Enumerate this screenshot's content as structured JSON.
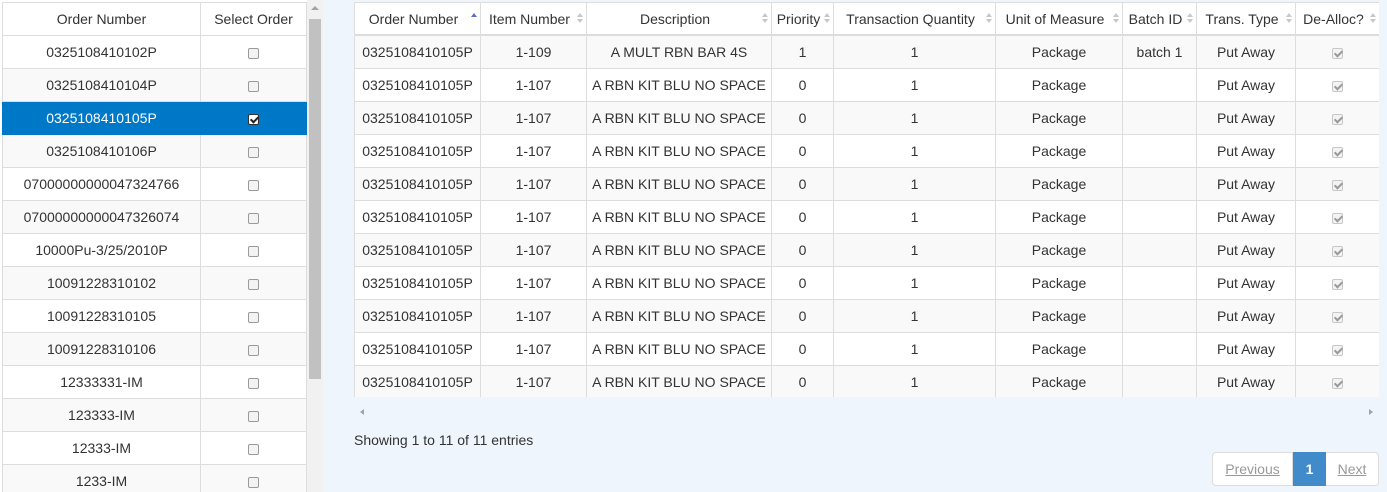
{
  "left": {
    "headers": [
      "Order Number",
      "Select Order"
    ],
    "rows": [
      {
        "order": "0325108410102P",
        "checked": false
      },
      {
        "order": "0325108410104P",
        "checked": false
      },
      {
        "order": "0325108410105P",
        "checked": true,
        "selected": true
      },
      {
        "order": "0325108410106P",
        "checked": false
      },
      {
        "order": "07000000000047324766",
        "checked": false
      },
      {
        "order": "07000000000047326074",
        "checked": false
      },
      {
        "order": "10000Pu-3/25/2010P",
        "checked": false
      },
      {
        "order": "10091228310102",
        "checked": false
      },
      {
        "order": "10091228310105",
        "checked": false
      },
      {
        "order": "10091228310106",
        "checked": false
      },
      {
        "order": "12333331-IM",
        "checked": false
      },
      {
        "order": "123333-IM",
        "checked": false
      },
      {
        "order": "12333-IM",
        "checked": false
      },
      {
        "order": "1233-IM",
        "checked": false
      }
    ]
  },
  "right": {
    "headers": [
      "Order Number",
      "Item Number",
      "Description",
      "Priority",
      "Transaction Quantity",
      "Unit of Measure",
      "Batch ID",
      "Trans. Type",
      "De-Alloc?"
    ],
    "rows": [
      [
        "0325108410105P",
        "1-109",
        "A MULT RBN BAR 4S",
        "1",
        "1",
        "Package",
        "batch 1",
        "Put Away"
      ],
      [
        "0325108410105P",
        "1-107",
        "A RBN KIT BLU NO SPACE",
        "0",
        "1",
        "Package",
        "",
        "Put Away"
      ],
      [
        "0325108410105P",
        "1-107",
        "A RBN KIT BLU NO SPACE",
        "0",
        "1",
        "Package",
        "",
        "Put Away"
      ],
      [
        "0325108410105P",
        "1-107",
        "A RBN KIT BLU NO SPACE",
        "0",
        "1",
        "Package",
        "",
        "Put Away"
      ],
      [
        "0325108410105P",
        "1-107",
        "A RBN KIT BLU NO SPACE",
        "0",
        "1",
        "Package",
        "",
        "Put Away"
      ],
      [
        "0325108410105P",
        "1-107",
        "A RBN KIT BLU NO SPACE",
        "0",
        "1",
        "Package",
        "",
        "Put Away"
      ],
      [
        "0325108410105P",
        "1-107",
        "A RBN KIT BLU NO SPACE",
        "0",
        "1",
        "Package",
        "",
        "Put Away"
      ],
      [
        "0325108410105P",
        "1-107",
        "A RBN KIT BLU NO SPACE",
        "0",
        "1",
        "Package",
        "",
        "Put Away"
      ],
      [
        "0325108410105P",
        "1-107",
        "A RBN KIT BLU NO SPACE",
        "0",
        "1",
        "Package",
        "",
        "Put Away"
      ],
      [
        "0325108410105P",
        "1-107",
        "A RBN KIT BLU NO SPACE",
        "0",
        "1",
        "Package",
        "",
        "Put Away"
      ],
      [
        "0325108410105P",
        "1-107",
        "A RBN KIT BLU NO SPACE",
        "0",
        "1",
        "Package",
        "",
        "Put Away"
      ]
    ],
    "info": "Showing 1 to 11 of 11 entries",
    "pagination": {
      "previous": "Previous",
      "current": "1",
      "next": "Next"
    }
  },
  "colors": {
    "selected_row": "#0078c8",
    "page_active": "#428bca",
    "panel_bg": "#eef5fc"
  }
}
